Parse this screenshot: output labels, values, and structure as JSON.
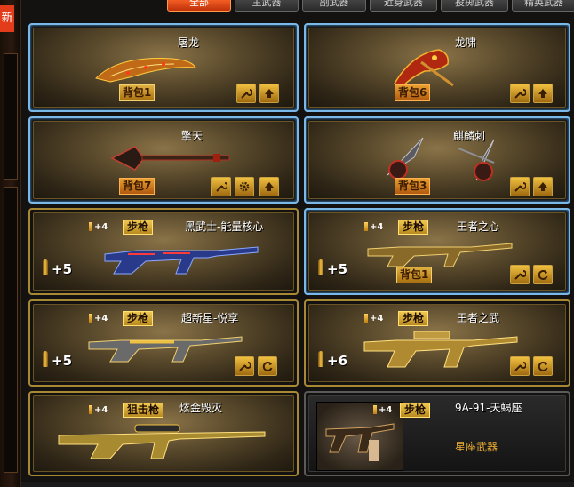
{
  "sidebar": {
    "badge": "新"
  },
  "tabs": [
    "全部",
    "主武器",
    "副武器",
    "近身武器",
    "投掷武器",
    "精英武器"
  ],
  "cards": [
    {
      "name": "屠龙",
      "bag": "背包1",
      "weapon_icon": "machete-icon"
    },
    {
      "name": "龙啸",
      "bag": "背包6",
      "weapon_icon": "dragon-axe-icon"
    },
    {
      "name": "擎天",
      "bag": "背包7",
      "weapon_icon": "shovel-icon"
    },
    {
      "name": "麒麟刺",
      "bag": "背包3",
      "weapon_icon": "claw-blades-icon"
    },
    {
      "name": "黑武士-能量核心",
      "type": "步枪",
      "plus": "+4",
      "level": "+5",
      "weapon_icon": "rifle-icon"
    },
    {
      "name": "王者之心",
      "type": "步枪",
      "plus": "+4",
      "level": "+5",
      "bag": "背包1",
      "weapon_icon": "rifle-icon"
    },
    {
      "name": "超新星-悦享",
      "type": "步枪",
      "plus": "+4",
      "level": "+5",
      "weapon_icon": "rifle-icon"
    },
    {
      "name": "王者之武",
      "type": "步枪",
      "plus": "+4",
      "level": "+6",
      "weapon_icon": "rifle-icon"
    },
    {
      "name": "炫金毁灭",
      "type": "狙击枪",
      "plus": "+4",
      "weapon_icon": "sniper-icon"
    },
    {
      "name": "9A-91-天蝎座",
      "type": "步枪",
      "plus": "+4",
      "subtitle": "星座武器",
      "weapon_icon": "rifle-icon"
    }
  ],
  "colors": {
    "accent_blue": "#7ab8e8",
    "gold": "#a88832",
    "tab_active": "#e24a14",
    "constellation_text": "#f0b030"
  }
}
